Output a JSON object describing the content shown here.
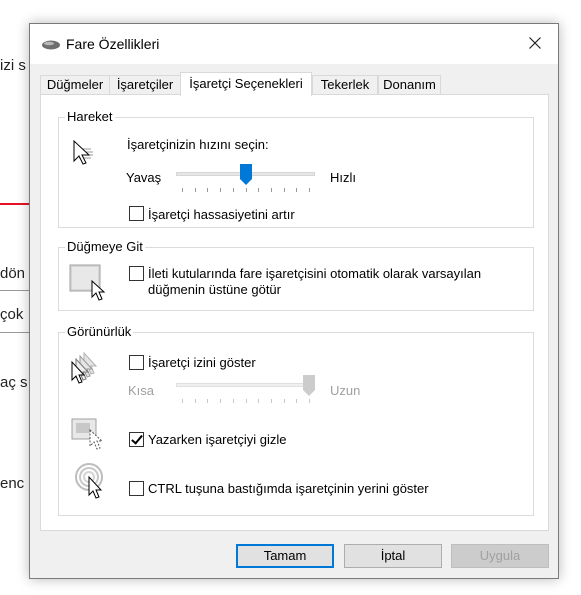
{
  "background": {
    "snippets": [
      "izi s",
      "dön",
      "çok",
      "aç s",
      "enc"
    ]
  },
  "dialog": {
    "title": "Fare Özellikleri",
    "title_icon": "mouse-icon",
    "close_icon": "close-icon",
    "tabs": [
      {
        "label": "Düğmeler"
      },
      {
        "label": "İşaretçiler"
      },
      {
        "label": "İşaretçi Seçenekleri",
        "active": true
      },
      {
        "label": "Tekerlek"
      },
      {
        "label": "Donanım"
      }
    ],
    "motion": {
      "group_label": "Hareket",
      "prompt": "İşaretçinizin hızını seçin:",
      "slow_label": "Yavaş",
      "fast_label": "Hızlı",
      "speed_fraction": 0.5,
      "precision_label": "İşaretçi hassasiyetini artır",
      "precision_checked": false
    },
    "snap": {
      "group_label": "Düğmeye Git",
      "label_line1": "İleti kutularında fare işaretçisini otomatik olarak varsayılan",
      "label_line2": "düğmenin üstüne götür",
      "checked": false
    },
    "visibility": {
      "group_label": "Görünürlük",
      "trails_label": "İşaretçi izini göster",
      "trails_checked": false,
      "short_label": "Kısa",
      "long_label": "Uzun",
      "trails_fraction": 1.0,
      "hide_label": "Yazarken işaretçiyi gizle",
      "hide_checked": true,
      "ctrl_label": "CTRL tuşuna bastığımda işaretçinin yerini göster",
      "ctrl_checked": false
    },
    "buttons": {
      "ok": "Tamam",
      "cancel": "İptal",
      "apply": "Uygula"
    },
    "colors": {
      "accent": "#0078d7",
      "slider_thumb": "#0078d7",
      "disabled_thumb": "#cccccc"
    }
  }
}
